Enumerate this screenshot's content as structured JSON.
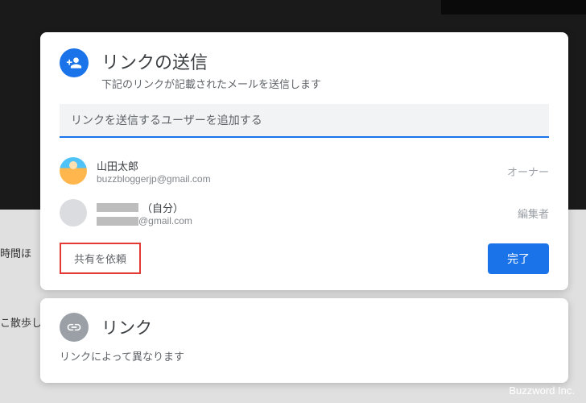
{
  "background": {
    "text1": "時間ほ",
    "text2": "こ散歩し"
  },
  "sendDialog": {
    "title": "リンクの送信",
    "subtitle": "下記のリンクが記載されたメールを送信します",
    "inputPlaceholder": "リンクを送信するユーザーを追加する",
    "users": [
      {
        "name": "山田太郎",
        "email": "buzzbloggerjp@gmail.com",
        "role": "オーナー"
      },
      {
        "nameSuffix": "（自分）",
        "emailSuffix": "@gmail.com",
        "role": "編集者"
      }
    ],
    "shareRequest": "共有を依頼",
    "doneButton": "完了"
  },
  "linkDialog": {
    "title": "リンク",
    "description": "リンクによって異なります"
  },
  "watermark": "Buzzword Inc."
}
